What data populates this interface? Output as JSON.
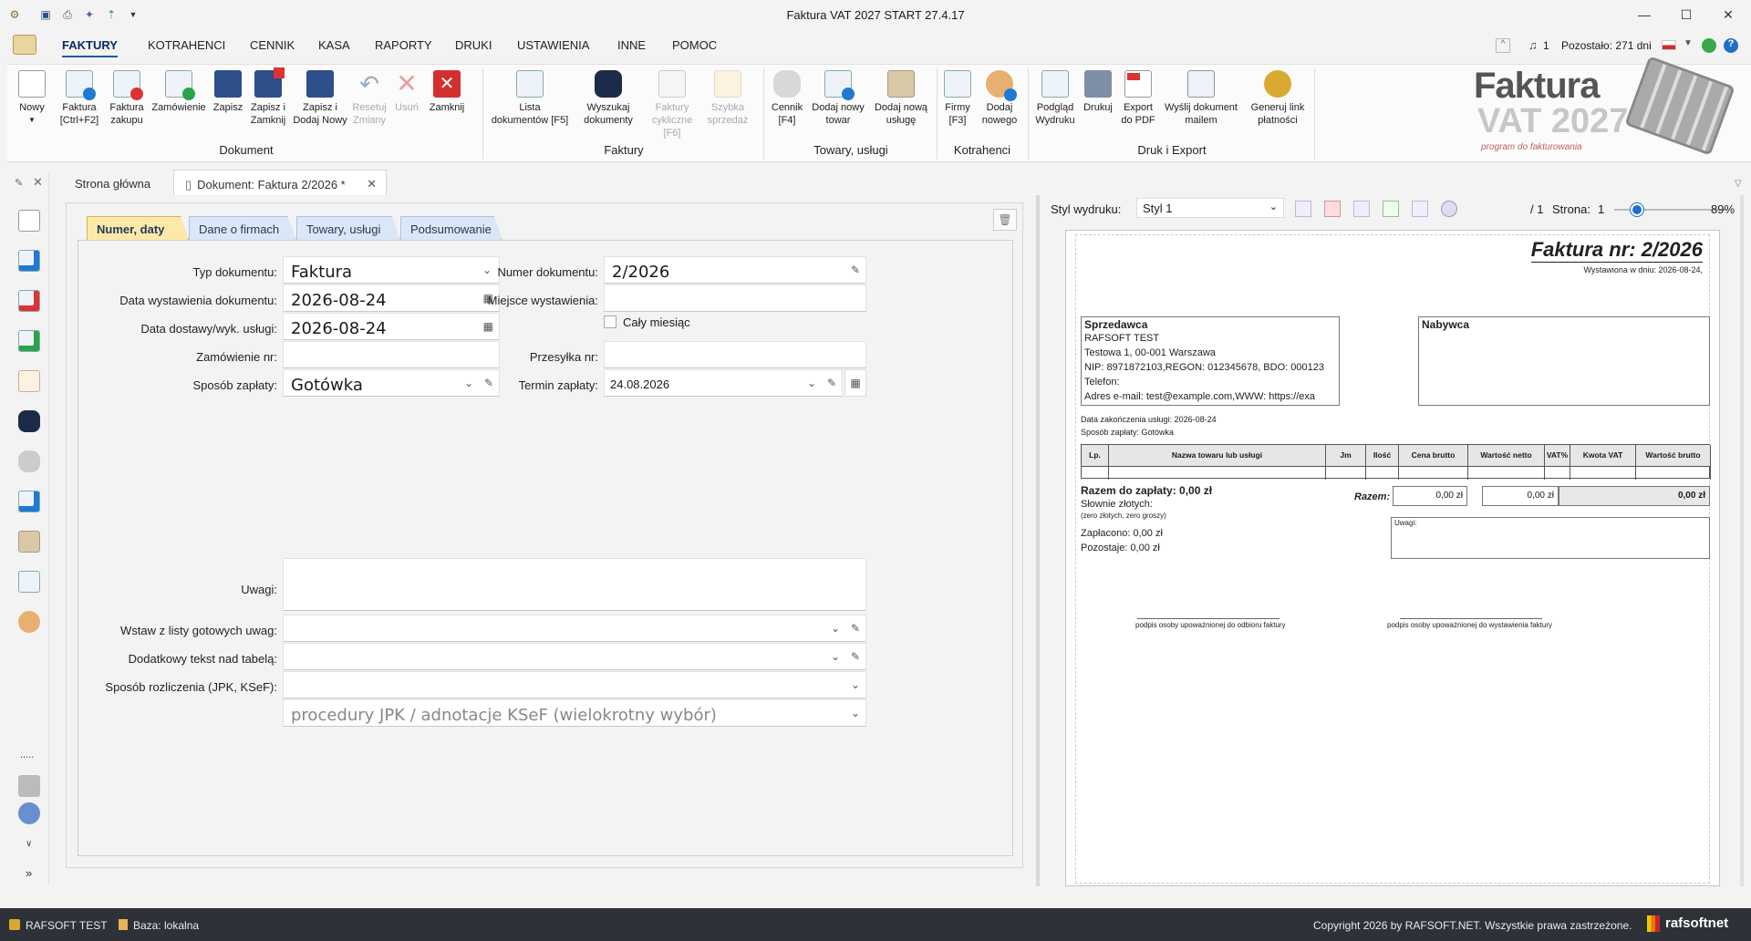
{
  "window": {
    "title": "Faktura VAT 2027 START 27.4.17",
    "minimize": "—",
    "maximize": "☐",
    "close": "✕"
  },
  "menu": {
    "items": [
      "FAKTURY",
      "KOTRAHENCI",
      "CENNIK",
      "KASA",
      "RAPORTY",
      "DRUKI",
      "USTAWIENIA",
      "INNE",
      "POMOC"
    ],
    "notifications": "1",
    "remaining": "Pozostało: 271 dni"
  },
  "ribbon": {
    "nowy": "Nowy",
    "faktura": "Faktura",
    "faktura_sc": "[Ctrl+F2]",
    "faktura_zakupu1": "Faktura",
    "faktura_zakupu2": "zakupu",
    "zamowienie": "Zamówienie",
    "zapisz": "Zapisz",
    "zapisz_zamknij1": "Zapisz i",
    "zapisz_zamknij2": "Zamknij",
    "zapisz_nowy1": "Zapisz i",
    "zapisz_nowy2": "Dodaj Nowy",
    "resetuj1": "Resetuj",
    "resetuj2": "Zmiany",
    "usun": "Usuń",
    "zamknij": "Zamknij",
    "group_dokument": "Dokument",
    "lista1": "Lista",
    "lista2": "dokumentów [F5]",
    "wyszukaj1": "Wyszukaj",
    "wyszukaj2": "dokumenty",
    "cykliczne1": "Faktury",
    "cykliczne2": "cykliczne [F6]",
    "szybka1": "Szybka",
    "szybka2": "sprzedaż",
    "group_faktury": "Faktury",
    "cennik1": "Cennik",
    "cennik2": "[F4]",
    "towar1": "Dodaj nowy",
    "towar2": "towar",
    "usluga1": "Dodaj nową",
    "usluga2": "usługę",
    "group_towary": "Towary, usługi",
    "firmy1": "Firmy",
    "firmy2": "[F3]",
    "dodaj1": "Dodaj",
    "dodaj2": "nowego",
    "group_kontrahenci": "Kotrahenci",
    "podglad1": "Podgląd",
    "podglad2": "Wydruku",
    "drukuj": "Drukuj",
    "pdf1": "Export",
    "pdf2": "do PDF",
    "mail1": "Wyślij dokument",
    "mail2": "mailem",
    "link1": "Generuj link",
    "link2": "płatności",
    "group_druk": "Druk i Export"
  },
  "logo": {
    "line1": "Faktura",
    "line2": "VAT 2027",
    "tagline": "program do fakturowania"
  },
  "tabs": {
    "home": "Strona główna",
    "doc": "Dokument: Faktura 2/2026 *"
  },
  "formtabs": [
    "Numer, daty",
    "Dane o firmach",
    "Towary, usługi",
    "Podsumowanie"
  ],
  "form": {
    "typ_label": "Typ dokumentu:",
    "typ_value": "Faktura",
    "data_wyst_label": "Data wystawienia dokumentu:",
    "data_wyst_value": "2026-08-24",
    "data_dost_label": "Data dostawy/wyk. usługi:",
    "data_dost_value": "2026-08-24",
    "zamowienie_label": "Zamówienie nr:",
    "zamowienie_value": "",
    "sposob_label": "Sposób zapłaty:",
    "sposob_value": "Gotówka",
    "numer_label": "Numer dokumentu:",
    "numer_value": "2/2026",
    "miejsce_label": "Miejsce wystawienia:",
    "miejsce_value": "",
    "caly_miesiac": "Cały miesiąc",
    "przesylka_label": "Przesyłka nr:",
    "przesylka_value": "",
    "termin_label": "Termin zapłaty:",
    "termin_value": "24.08.2026",
    "uwagi_label": "Uwagi:",
    "uwagi_value": "",
    "wstaw_label": "Wstaw z listy gotowych uwag:",
    "dodatkowy_label": "Dodatkowy tekst nad tabelą:",
    "rozliczenie_label": "Sposób rozliczenia (JPK, KSeF):",
    "procedury_placeholder": "procedury JPK / adnotacje KSeF (wielokrotny wybór)"
  },
  "preview": {
    "styl_label": "Styl wydruku:",
    "styl_value": "Styl 1",
    "pages": "/ 1",
    "strona_label": "Strona:",
    "strona_value": "1",
    "zoom": "89%",
    "zoom_fraction": 0.2
  },
  "invoice": {
    "title": "Faktura nr: 2/2026",
    "wystawiona": "Wystawiona w dniu: 2026-08-24,",
    "sprzedawca": "Sprzedawca",
    "s1": "RAFSOFT TEST",
    "s2": "Testowa 1, 00-001 Warszawa",
    "s3": "NIP: 8971872103,REGON: 012345678, BDO: 000123",
    "s4": "Telefon:",
    "s5": "Adres e-mail: test@example.com,WWW: https://exa",
    "nabywca": "Nabywca",
    "data_zak": "Data zakończenia usługi: 2026-08-24",
    "sposob": "Sposób zapłaty: Gotówka",
    "cols": [
      "Lp.",
      "Nazwa towaru lub usługi",
      "Jm",
      "Ilość",
      "Cena brutto",
      "Wartość netto",
      "VAT%",
      "Kwota VAT",
      "Wartość brutto"
    ],
    "razem_zaplaty": "Razem do zapłaty: 0,00 zł",
    "slownie": "Słownie złotych:",
    "slownie2": "(zero złotych, zero groszy)",
    "razem": "Razem:",
    "r1": "0,00 zł",
    "r2": "0,00 zł",
    "r3": "0,00 zł",
    "uwagi": "Uwagi:",
    "zaplacono": "Zapłacono:  0,00 zł",
    "pozostaje": "Pozostaje:  0,00 zł",
    "podpis1": "podpis osoby upoważnionej do odbioru faktury",
    "podpis2": "podpis osoby upoważnionej do wystawienia faktury"
  },
  "status": {
    "user": "RAFSOFT TEST",
    "baza": "Baza: lokalna",
    "copyright": "Copyright 2026 by RAFSOFT.NET. Wszystkie prawa zastrzeżone.",
    "brand": "rafsoftnet"
  },
  "leftbar": {
    "dots": ".....",
    "more": "»"
  }
}
